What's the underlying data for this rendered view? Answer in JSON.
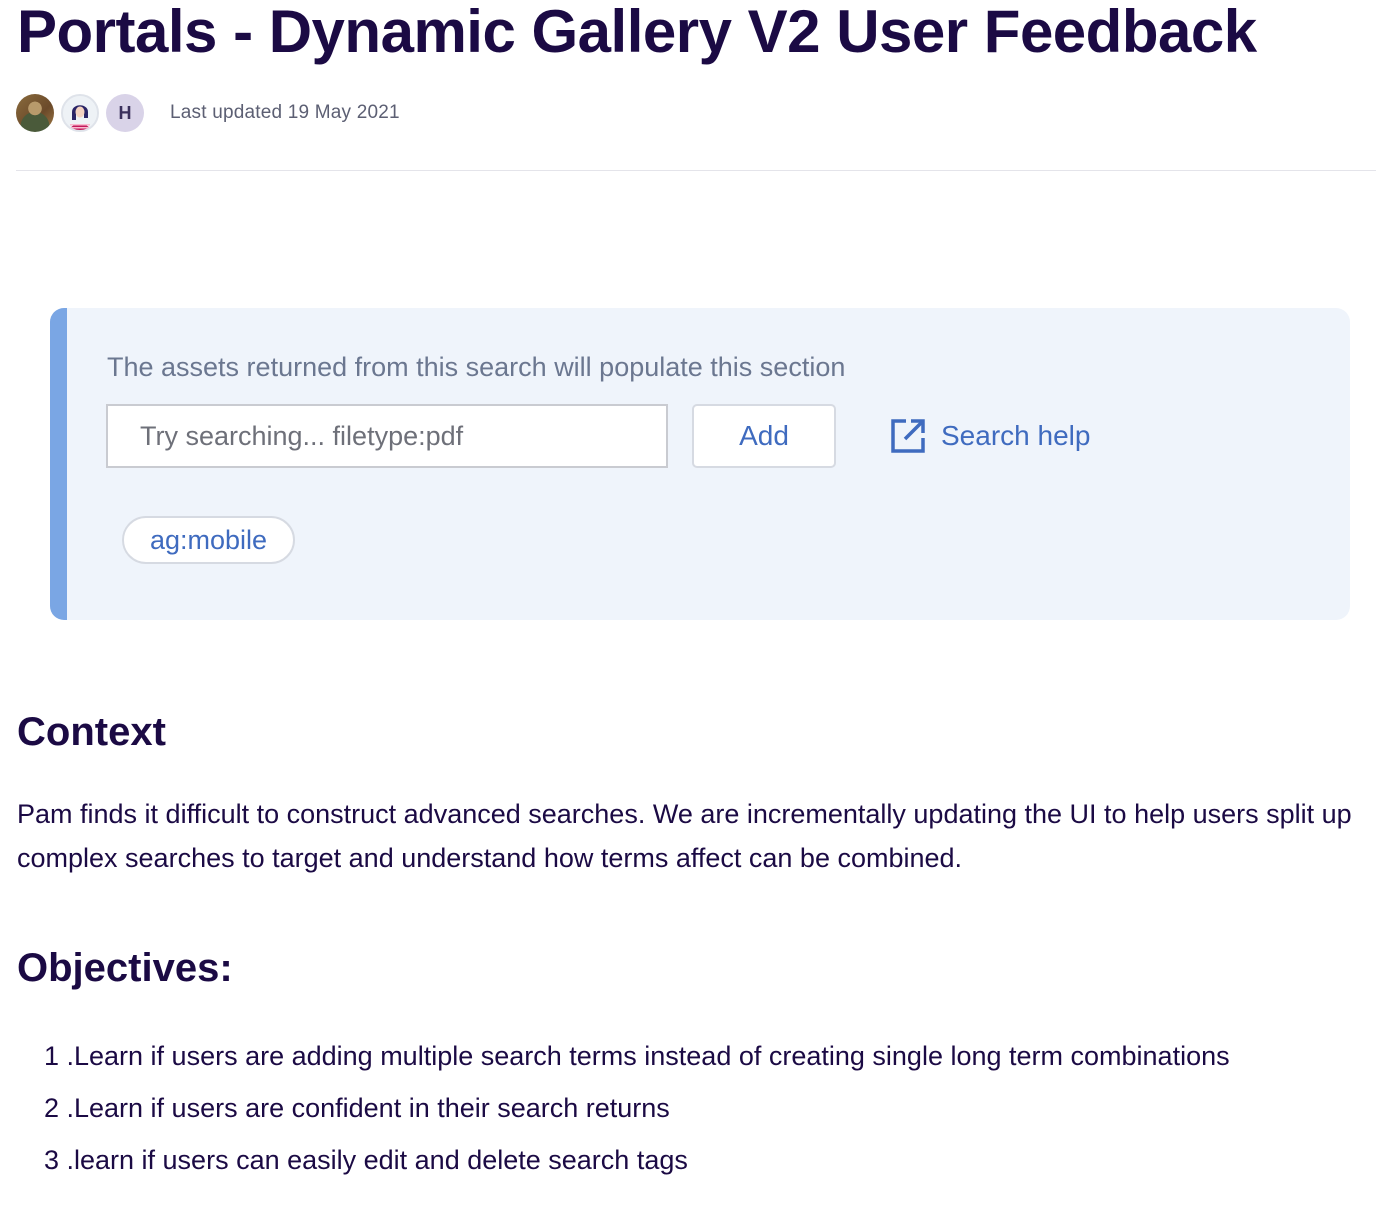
{
  "page": {
    "title": "Portals - Dynamic Gallery V2 User Feedback",
    "last_updated": "Last updated 19 May 2021"
  },
  "avatars": [
    {
      "type": "photo",
      "icon": "person-photo-avatar"
    },
    {
      "type": "illustration",
      "icon": "illustrated-person-avatar"
    },
    {
      "type": "initial",
      "initial": "H"
    }
  ],
  "gallery_panel": {
    "hint": "The assets returned from this search will populate this section",
    "search_placeholder": "Try searching... filetype:pdf",
    "add_label": "Add",
    "search_help_label": "Search help",
    "search_help_icon": "external-link-icon",
    "tags": [
      "ag:mobile"
    ],
    "accent_color": "#7aa6e4",
    "background_color": "#eff4fb",
    "link_color": "#3f6bbf"
  },
  "context": {
    "heading": "Context",
    "body": "Pam finds it difficult to construct advanced searches. We are incrementally updating the UI to help users split up complex searches to target and understand how terms affect can be combined."
  },
  "objectives": {
    "heading": "Objectives:",
    "items": [
      {
        "number": "1 .",
        "text": "Learn if users are adding multiple search terms instead of creating single long term combinations"
      },
      {
        "number": "2 .",
        "text": "Learn if users are confident in their search returns"
      },
      {
        "number": "3 .",
        "text": "learn if users can easily edit and delete search tags"
      }
    ]
  },
  "colors": {
    "text_primary": "#1b0a44",
    "text_muted": "#5c5f73"
  }
}
